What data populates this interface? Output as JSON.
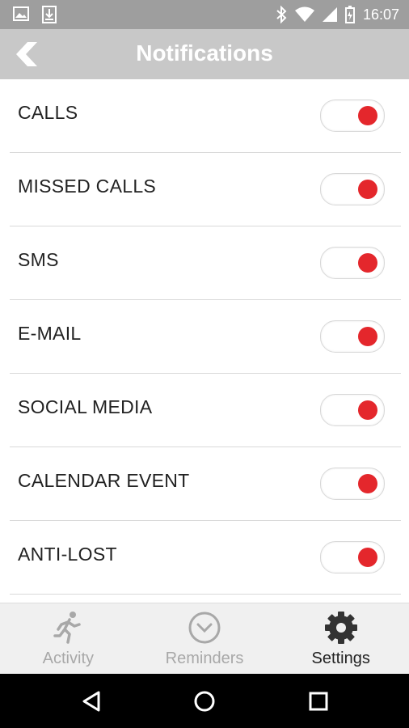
{
  "status_bar": {
    "time": "16:07",
    "left_icons": [
      "image-icon",
      "download-icon"
    ],
    "right_icons": [
      "bluetooth-icon",
      "wifi-icon",
      "signal-icon",
      "battery-icon"
    ]
  },
  "header": {
    "title": "Notifications",
    "back_icon": "chevron-left-icon"
  },
  "notifications": [
    {
      "label": "CALLS",
      "enabled": true
    },
    {
      "label": "MISSED CALLS",
      "enabled": true
    },
    {
      "label": "SMS",
      "enabled": true
    },
    {
      "label": "E-MAIL",
      "enabled": true
    },
    {
      "label": "SOCIAL MEDIA",
      "enabled": true
    },
    {
      "label": "CALENDAR EVENT",
      "enabled": true
    },
    {
      "label": "ANTI-LOST",
      "enabled": true
    }
  ],
  "tabs": [
    {
      "label": "Activity",
      "icon": "runner-icon",
      "active": false
    },
    {
      "label": "Reminders",
      "icon": "clock-icon",
      "active": false
    },
    {
      "label": "Settings",
      "icon": "gear-icon",
      "active": true
    }
  ],
  "colors": {
    "accent": "#e4272c",
    "status_bar": "#9e9e9e",
    "app_bar": "#c8c8c8",
    "inactive_tab": "#a8a8a8"
  }
}
